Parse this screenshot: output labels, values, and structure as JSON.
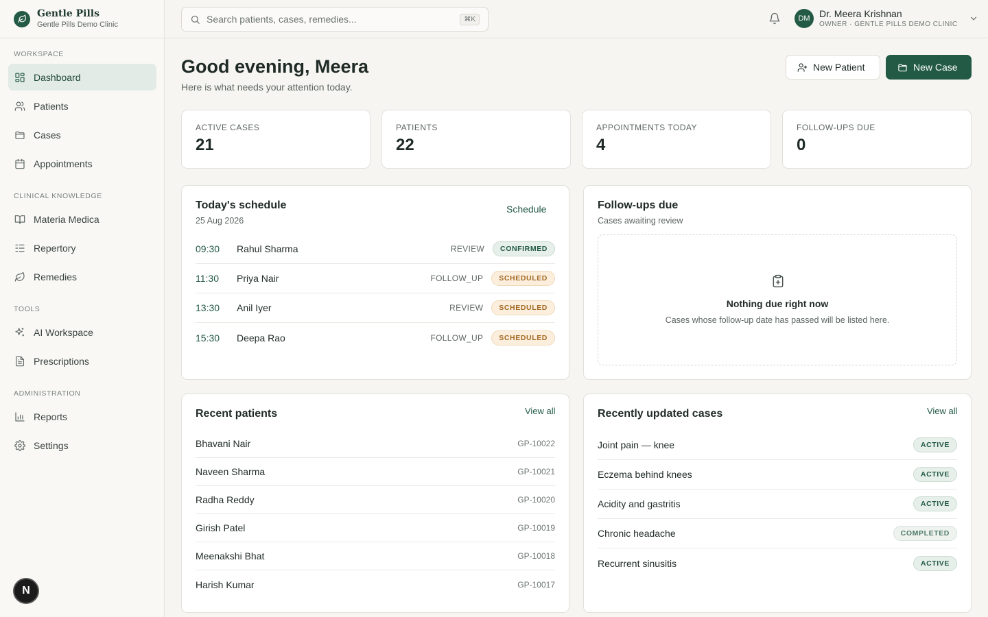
{
  "brand": {
    "name": "Gentle Pills",
    "clinic": "Gentle Pills Demo Clinic"
  },
  "nav": {
    "sections": [
      {
        "heading": "WORKSPACE",
        "items": [
          {
            "label": "Dashboard",
            "icon": "dashboard-icon",
            "active": true
          },
          {
            "label": "Patients",
            "icon": "users-icon"
          },
          {
            "label": "Cases",
            "icon": "folder-icon"
          },
          {
            "label": "Appointments",
            "icon": "calendar-icon"
          }
        ]
      },
      {
        "heading": "CLINICAL KNOWLEDGE",
        "items": [
          {
            "label": "Materia Medica",
            "icon": "book-icon"
          },
          {
            "label": "Repertory",
            "icon": "list-icon"
          },
          {
            "label": "Remedies",
            "icon": "leaf-icon"
          }
        ]
      },
      {
        "heading": "TOOLS",
        "items": [
          {
            "label": "AI Workspace",
            "icon": "sparkles-icon"
          },
          {
            "label": "Prescriptions",
            "icon": "document-icon"
          }
        ]
      },
      {
        "heading": "ADMINISTRATION",
        "items": [
          {
            "label": "Reports",
            "icon": "bar-chart-icon"
          },
          {
            "label": "Settings",
            "icon": "gear-icon"
          }
        ]
      }
    ]
  },
  "next_badge": "N",
  "search": {
    "placeholder": "Search patients, cases, remedies...",
    "shortcut": "⌘K"
  },
  "user": {
    "initials": "DM",
    "name": "Dr. Meera Krishnan",
    "role": "OWNER · GENTLE PILLS DEMO CLINIC"
  },
  "header": {
    "greeting": "Good evening, Meera",
    "subtitle": "Here is what needs your attention today."
  },
  "actions": {
    "new_patient": "New Patient",
    "new_case": "New Case"
  },
  "stats": [
    {
      "label": "ACTIVE CASES",
      "value": "21"
    },
    {
      "label": "PATIENTS",
      "value": "22"
    },
    {
      "label": "APPOINTMENTS TODAY",
      "value": "4"
    },
    {
      "label": "FOLLOW-UPS DUE",
      "value": "0"
    }
  ],
  "schedule": {
    "title": "Today's schedule",
    "date": "25 Aug 2026",
    "link": "Schedule",
    "rows": [
      {
        "time": "09:30",
        "name": "Rahul Sharma",
        "type": "REVIEW",
        "status": "CONFIRMED"
      },
      {
        "time": "11:30",
        "name": "Priya Nair",
        "type": "FOLLOW_UP",
        "status": "SCHEDULED"
      },
      {
        "time": "13:30",
        "name": "Anil Iyer",
        "type": "REVIEW",
        "status": "SCHEDULED"
      },
      {
        "time": "15:30",
        "name": "Deepa Rao",
        "type": "FOLLOW_UP",
        "status": "SCHEDULED"
      }
    ]
  },
  "followups": {
    "title": "Follow-ups due",
    "subtitle": "Cases awaiting review",
    "empty_title": "Nothing due right now",
    "empty_text": "Cases whose follow-up date has passed will be listed here."
  },
  "recent_patients": {
    "title": "Recent patients",
    "link": "View all",
    "rows": [
      {
        "name": "Bhavani Nair",
        "id": "GP-10022"
      },
      {
        "name": "Naveen Sharma",
        "id": "GP-10021"
      },
      {
        "name": "Radha Reddy",
        "id": "GP-10020"
      },
      {
        "name": "Girish Patel",
        "id": "GP-10019"
      },
      {
        "name": "Meenakshi Bhat",
        "id": "GP-10018"
      },
      {
        "name": "Harish Kumar",
        "id": "GP-10017"
      }
    ]
  },
  "recent_cases": {
    "title": "Recently updated cases",
    "link": "View all",
    "rows": [
      {
        "name": "Joint pain — knee",
        "status": "ACTIVE"
      },
      {
        "name": "Eczema behind knees",
        "status": "ACTIVE"
      },
      {
        "name": "Acidity and gastritis",
        "status": "ACTIVE"
      },
      {
        "name": "Chronic headache",
        "status": "COMPLETED"
      },
      {
        "name": "Recurrent sinusitis",
        "status": "ACTIVE"
      }
    ]
  },
  "colors": {
    "accent": "#235a45",
    "background": "#f6f5f1",
    "scheduled": "#a36a24"
  }
}
